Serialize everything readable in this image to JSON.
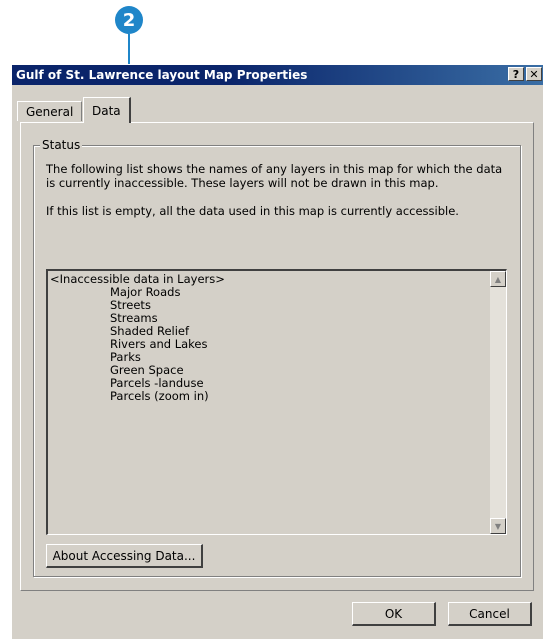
{
  "callout": {
    "number": "2"
  },
  "window": {
    "title": "Gulf of St. Lawrence layout Map Properties",
    "help_button": "?",
    "close_button": "✕"
  },
  "tabs": [
    {
      "label": "General"
    },
    {
      "label": "Data"
    }
  ],
  "status": {
    "group_label": "Status",
    "description": "The following list shows the names of any layers in this map for which the data is currently inaccessible. These layers will not be drawn in this map.",
    "empty_note": "If this list is empty, all the data used in this map is currently accessible."
  },
  "list": {
    "header": "<Inaccessible data in Layers>",
    "items": [
      "Major Roads",
      "Streets",
      "Streams",
      "Shaded Relief",
      "Rivers and Lakes",
      "Parks",
      "Green Space",
      "Parcels -landuse",
      "Parcels (zoom in)"
    ],
    "scroll_up": "▲",
    "scroll_down": "▼"
  },
  "buttons": {
    "about": "About Accessing Data...",
    "ok": "OK",
    "cancel": "Cancel"
  }
}
